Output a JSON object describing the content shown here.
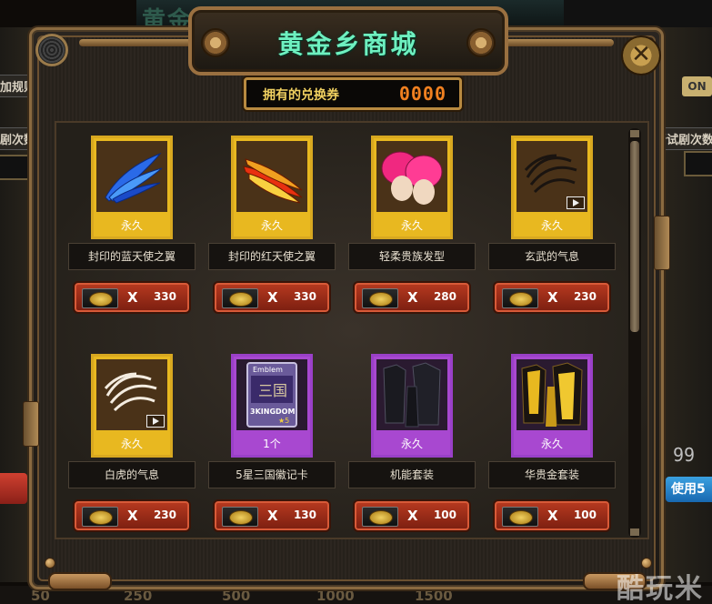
{
  "shop": {
    "title": "黄金乡商城",
    "voucher_label": "拥有的兑换券",
    "voucher_count": "0000",
    "close_label": "✕"
  },
  "background": {
    "title": "黄金乡",
    "left_labels": [
      "加规则",
      "剧次数"
    ],
    "right_labels": [
      "新试剧次数"
    ],
    "on_label": "ON",
    "right_number": "99",
    "use_label": "使用5",
    "axis_ticks": [
      "50",
      "250",
      "500",
      "1000",
      "1500"
    ],
    "watermark": "酷玩米"
  },
  "items": [
    {
      "name": "封印的蓝天使之翼",
      "duration": "永久",
      "price_x": "X",
      "price": "330",
      "rarity": "gold",
      "icon": "blue-wing-icon"
    },
    {
      "name": "封印的红天使之翼",
      "duration": "永久",
      "price_x": "X",
      "price": "330",
      "rarity": "gold",
      "icon": "red-wing-icon"
    },
    {
      "name": "轻柔贵族发型",
      "duration": "永久",
      "price_x": "X",
      "price": "280",
      "rarity": "gold",
      "icon": "pink-hair-icon"
    },
    {
      "name": "玄武的气息",
      "duration": "永久",
      "price_x": "X",
      "price": "230",
      "rarity": "gold",
      "icon": "black-aura-icon"
    },
    {
      "name": "白虎的气息",
      "duration": "永久",
      "price_x": "X",
      "price": "230",
      "rarity": "gold",
      "icon": "white-aura-icon"
    },
    {
      "name": "5星三国徽记卡",
      "duration": "1个",
      "price_x": "X",
      "price": "130",
      "rarity": "purple",
      "icon": "emblem-card-icon",
      "card_top": "Emblem",
      "card_mid": "三国",
      "card_bottom": "3KINGDOM",
      "card_stars": "★5"
    },
    {
      "name": "机能套装",
      "duration": "永久",
      "price_x": "X",
      "price": "100",
      "rarity": "purple",
      "icon": "black-suit-icon"
    },
    {
      "name": "华贵金套装",
      "duration": "永久",
      "price_x": "X",
      "price": "100",
      "rarity": "purple",
      "icon": "gold-suit-icon"
    }
  ],
  "colors": {
    "gold_frame": "#e8b820",
    "purple_frame": "#a848d0",
    "title_green": "#6ef0c0",
    "counter_orange": "#f08020",
    "price_red": "#b83a20"
  }
}
